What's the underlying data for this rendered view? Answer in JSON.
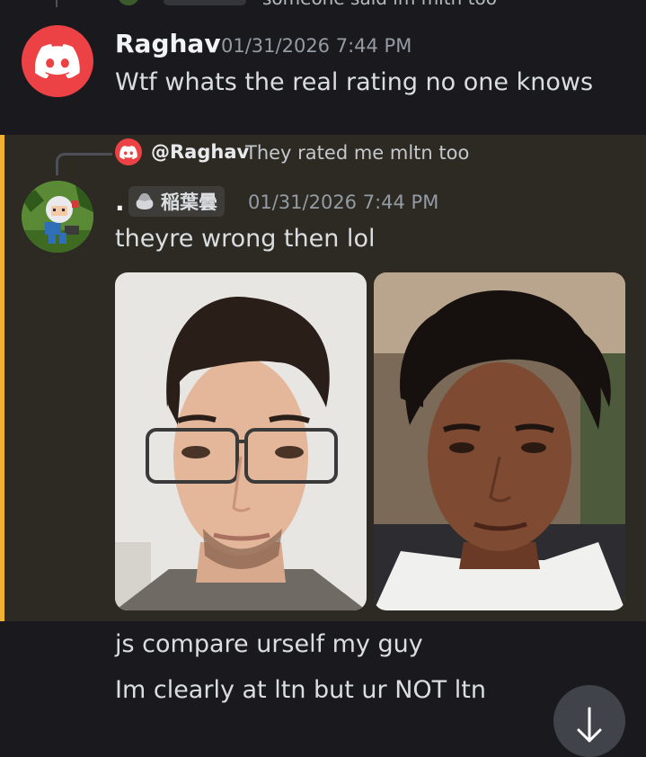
{
  "previous_reply": {
    "text": "someone said im mltn too"
  },
  "message1": {
    "username": "Raghav",
    "timestamp": "01/31/2026 7:44 PM",
    "text": "Wtf whats the real rating no one knows",
    "avatar_icon": "discord-logo-icon",
    "avatar_color": "#ed4245"
  },
  "message2": {
    "reply": {
      "mention": "@Raghav",
      "text": "They rated me mltn too"
    },
    "display_name": ".",
    "clan_tag": "稲葉曇",
    "timestamp": "01/31/2026 7:44 PM",
    "text": "theyre wrong then lol",
    "highlight_color": "#f0b232",
    "attachments": [
      {
        "name": "photo-1"
      },
      {
        "name": "photo-2"
      }
    ]
  },
  "followups": [
    "js compare urself my guy",
    "Im clearly at ltn but ur NOT ltn"
  ],
  "scroll_button": {
    "icon": "arrow-down-icon"
  }
}
